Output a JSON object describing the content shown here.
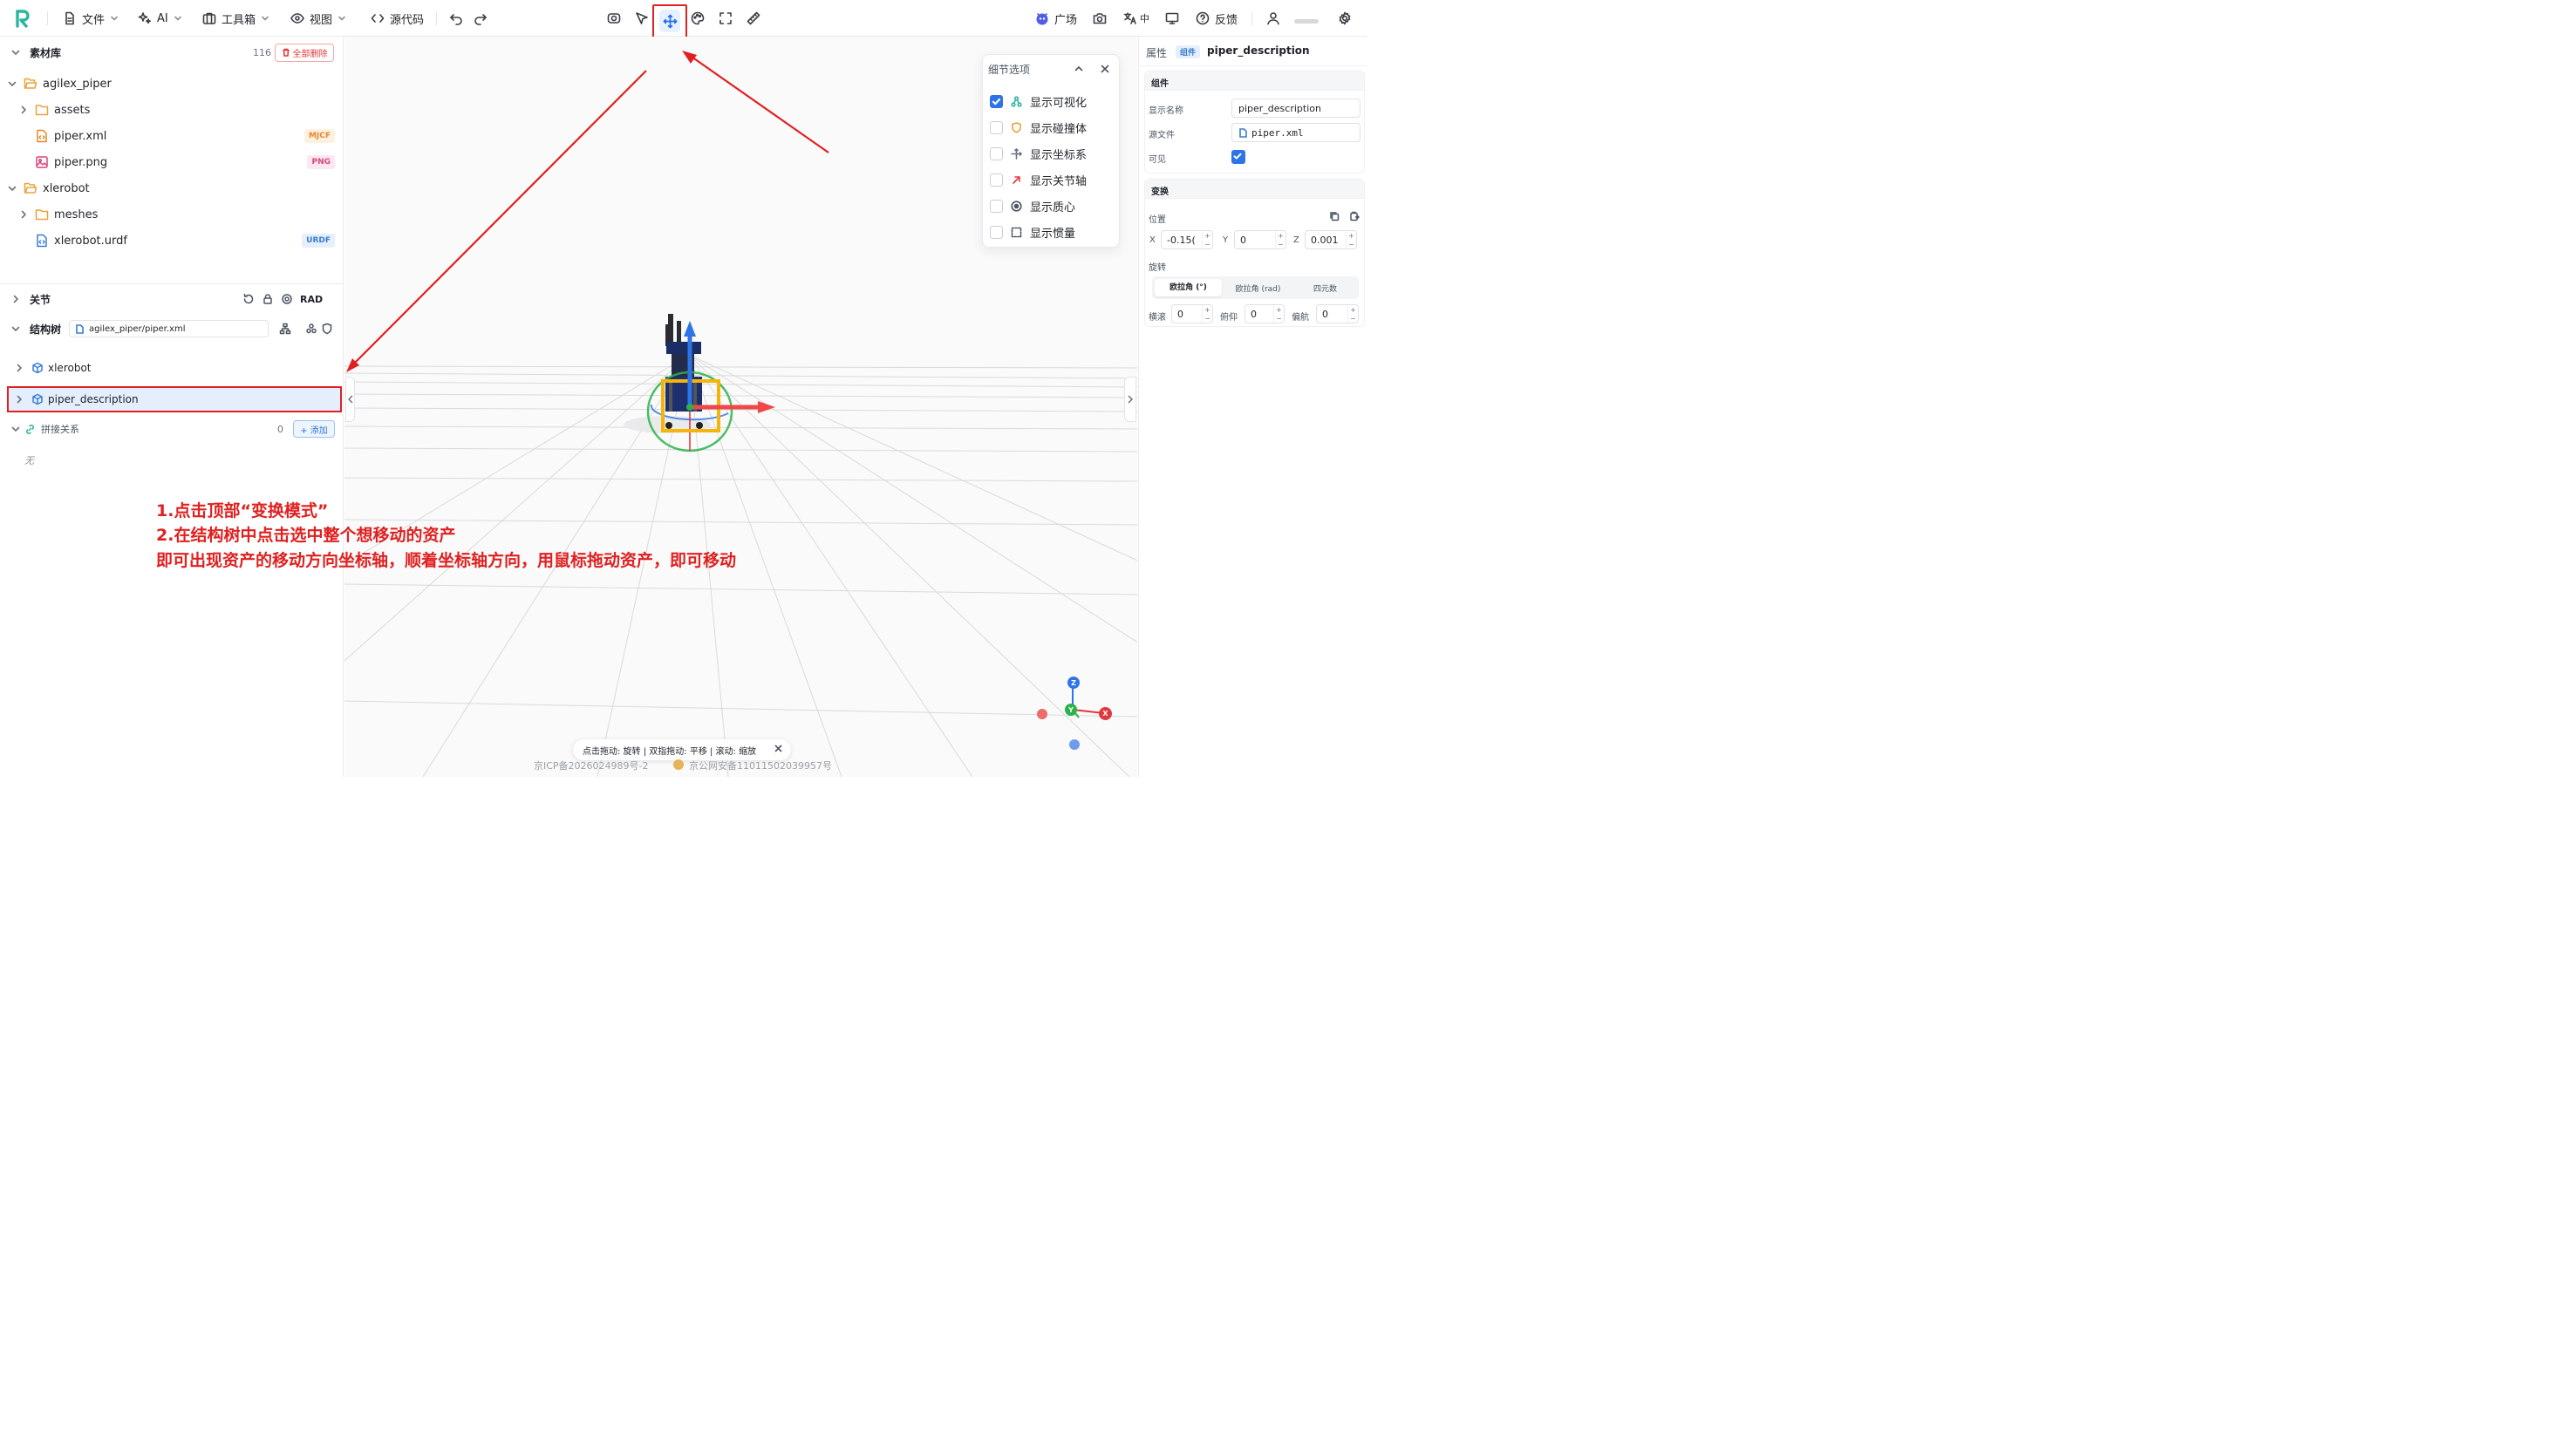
{
  "toolbar": {
    "file": "文件",
    "ai": "AI",
    "toolbox": "工具箱",
    "view": "视图",
    "source": "源代码",
    "plaza": "广场",
    "lang": "中",
    "feedback": "反馈"
  },
  "assets": {
    "title": "素材库",
    "count": "116",
    "delete_all": "全部删除",
    "items": [
      {
        "label": "agilex_piper",
        "kind": "folder"
      },
      {
        "label": "assets",
        "kind": "folder"
      },
      {
        "label": "piper.xml",
        "kind": "file",
        "tag": "MJCF"
      },
      {
        "label": "piper.png",
        "kind": "image",
        "tag": "PNG"
      },
      {
        "label": "xlerobot",
        "kind": "folder"
      },
      {
        "label": "meshes",
        "kind": "folder"
      },
      {
        "label": "xlerobot.urdf",
        "kind": "file",
        "tag": "URDF"
      }
    ]
  },
  "joints": {
    "title": "关节",
    "unit": "RAD"
  },
  "structure": {
    "title": "结构树",
    "path": "agilex_piper/piper.xml",
    "items": [
      {
        "label": "xlerobot"
      },
      {
        "label": "piper_description"
      }
    ]
  },
  "splice": {
    "title": "拼接关系",
    "count": "0",
    "add": "+ 添加",
    "empty": "无"
  },
  "details": {
    "title": "细节选项",
    "options": [
      {
        "label": "显示可视化",
        "checked": true
      },
      {
        "label": "显示碰撞体",
        "checked": false
      },
      {
        "label": "显示坐标系",
        "checked": false
      },
      {
        "label": "显示关节轴",
        "checked": false
      },
      {
        "label": "显示质心",
        "checked": false
      },
      {
        "label": "显示惯量",
        "checked": false
      }
    ]
  },
  "annotation": {
    "line1": "1.点击顶部“变换模式”",
    "line2": "2.在结构树中点击选中整个想移动的资产",
    "line3": "即可出现资产的移动方向坐标轴，顺着坐标轴方向，用鼠标拖动资产，即可移动"
  },
  "hint": "点击拖动: 旋转 | 双指拖动: 平移 | 滚动: 缩放",
  "footer": {
    "icp": "京ICP备2026024989号-2",
    "police": "京公网安备11011502039957号"
  },
  "properties": {
    "title": "属性",
    "badge": "组件",
    "name": "piper_description",
    "component": {
      "title": "组件",
      "display_name_label": "显示名称",
      "display_name": "piper_description",
      "source_label": "源文件",
      "source": "piper.xml",
      "visible_label": "可见",
      "visible": true
    },
    "transform": {
      "title": "变换",
      "position_label": "位置",
      "x_label": "X",
      "x": "-0.15(",
      "y_label": "Y",
      "y": "0",
      "z_label": "Z",
      "z": "0.001",
      "rotation_label": "旋转",
      "tabs": [
        "欧拉角 (°)",
        "欧拉角 (rad)",
        "四元数"
      ],
      "roll_label": "横滚",
      "roll": "0",
      "pitch_label": "俯仰",
      "pitch": "0",
      "yaw_label": "偏航",
      "yaw": "0"
    }
  },
  "gizmo": {
    "z": "Z",
    "y": "Y",
    "x": "X"
  },
  "colors": {
    "accent": "#2f74e6",
    "annotation": "#e02020"
  }
}
